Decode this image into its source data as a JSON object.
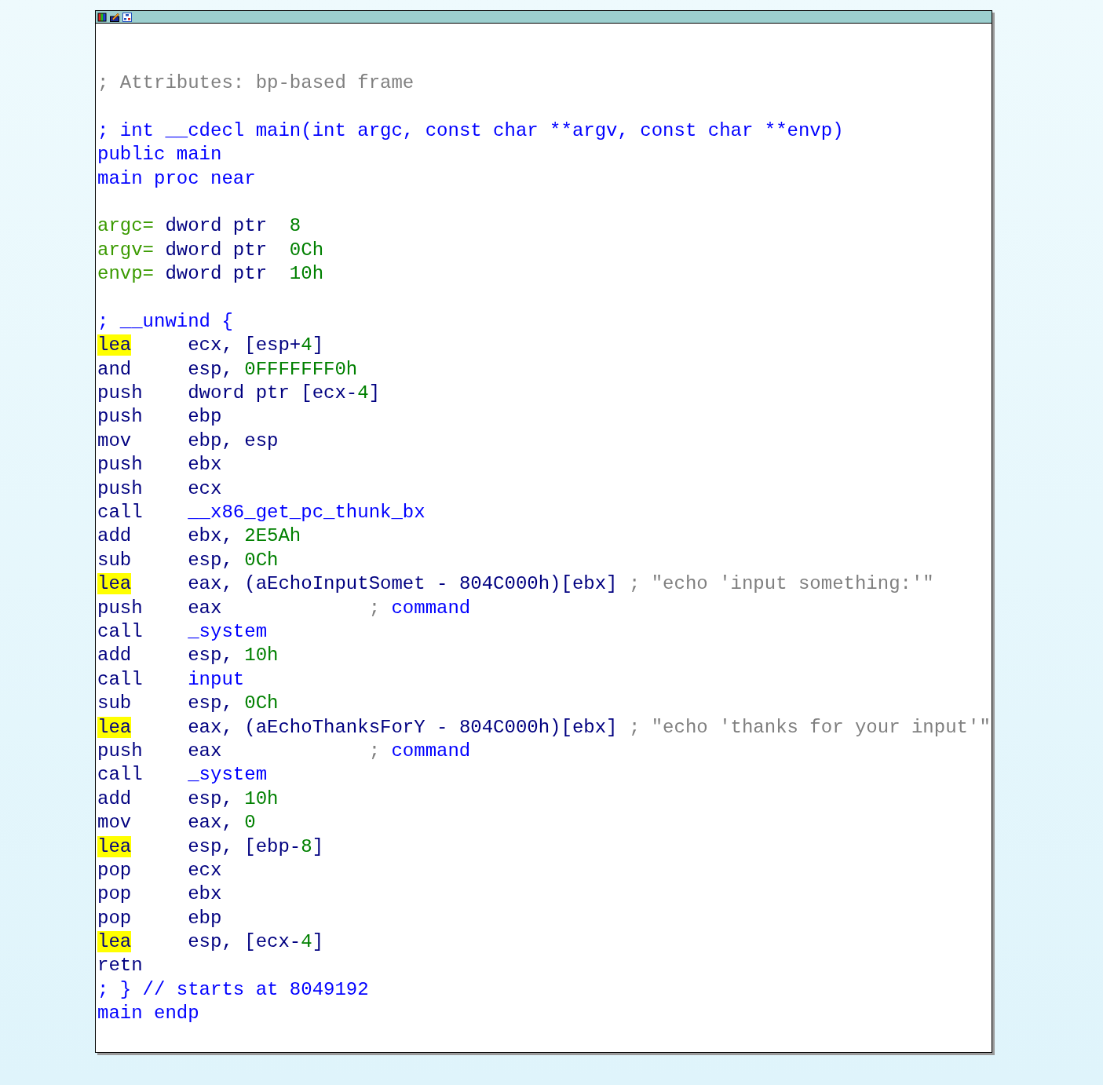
{
  "lines": [
    {
      "kind": "text",
      "spans": [
        {
          "text": "; Attributes: bp-based frame",
          "kind": "comment"
        }
      ]
    },
    {
      "kind": "blank"
    },
    {
      "kind": "text",
      "spans": [
        {
          "text": "; int __cdecl main(int argc, const char **argv, const char **envp)",
          "kind": "name"
        }
      ]
    },
    {
      "kind": "text",
      "spans": [
        {
          "text": "public main",
          "kind": "name"
        }
      ]
    },
    {
      "kind": "text",
      "spans": [
        {
          "text": "main proc near",
          "kind": "name"
        }
      ]
    },
    {
      "kind": "blank"
    },
    {
      "kind": "text",
      "spans": [
        {
          "text": "argc=",
          "kind": "var"
        },
        {
          "text": " dword ptr  ",
          "kind": "plain"
        },
        {
          "text": "8",
          "kind": "number"
        }
      ]
    },
    {
      "kind": "text",
      "spans": [
        {
          "text": "argv=",
          "kind": "var"
        },
        {
          "text": " dword ptr  ",
          "kind": "plain"
        },
        {
          "text": "0Ch",
          "kind": "number"
        }
      ]
    },
    {
      "kind": "text",
      "spans": [
        {
          "text": "envp=",
          "kind": "var"
        },
        {
          "text": " dword ptr  ",
          "kind": "plain"
        },
        {
          "text": "10h",
          "kind": "number"
        }
      ]
    },
    {
      "kind": "blank"
    },
    {
      "kind": "text",
      "spans": [
        {
          "text": "; __unwind {",
          "kind": "name"
        }
      ]
    },
    {
      "kind": "instr",
      "mnemonic": "lea",
      "highlighted": true,
      "operands": [
        {
          "text": "ecx, [esp+",
          "kind": "plain"
        },
        {
          "text": "4",
          "kind": "number"
        },
        {
          "text": "]",
          "kind": "plain"
        }
      ]
    },
    {
      "kind": "instr",
      "mnemonic": "and",
      "highlighted": false,
      "operands": [
        {
          "text": "esp, ",
          "kind": "plain"
        },
        {
          "text": "0FFFFFFF0h",
          "kind": "number"
        }
      ]
    },
    {
      "kind": "instr",
      "mnemonic": "push",
      "highlighted": false,
      "operands": [
        {
          "text": "dword ptr [ecx-",
          "kind": "plain"
        },
        {
          "text": "4",
          "kind": "number"
        },
        {
          "text": "]",
          "kind": "plain"
        }
      ]
    },
    {
      "kind": "instr",
      "mnemonic": "push",
      "highlighted": false,
      "operands": [
        {
          "text": "ebp",
          "kind": "plain"
        }
      ]
    },
    {
      "kind": "instr",
      "mnemonic": "mov",
      "highlighted": false,
      "operands": [
        {
          "text": "ebp, esp",
          "kind": "plain"
        }
      ]
    },
    {
      "kind": "instr",
      "mnemonic": "push",
      "highlighted": false,
      "operands": [
        {
          "text": "ebx",
          "kind": "plain"
        }
      ]
    },
    {
      "kind": "instr",
      "mnemonic": "push",
      "highlighted": false,
      "operands": [
        {
          "text": "ecx",
          "kind": "plain"
        }
      ]
    },
    {
      "kind": "instr",
      "mnemonic": "call",
      "highlighted": false,
      "operands": [
        {
          "text": "__x86_get_pc_thunk_bx",
          "kind": "name"
        }
      ]
    },
    {
      "kind": "instr",
      "mnemonic": "add",
      "highlighted": false,
      "operands": [
        {
          "text": "ebx, ",
          "kind": "plain"
        },
        {
          "text": "2E5Ah",
          "kind": "number"
        }
      ]
    },
    {
      "kind": "instr",
      "mnemonic": "sub",
      "highlighted": false,
      "operands": [
        {
          "text": "esp, ",
          "kind": "plain"
        },
        {
          "text": "0Ch",
          "kind": "number"
        }
      ]
    },
    {
      "kind": "instr",
      "mnemonic": "lea",
      "highlighted": true,
      "operands": [
        {
          "text": "eax, (aEchoInputSomet - 804C000h)[ebx]",
          "kind": "plain"
        }
      ],
      "comment": [
        {
          "text": "; \"echo 'input something:'\"",
          "kind": "comment"
        }
      ]
    },
    {
      "kind": "instr",
      "mnemonic": "push",
      "highlighted": false,
      "operands": [
        {
          "text": "eax",
          "kind": "plain"
        }
      ],
      "comment": [
        {
          "text": "; ",
          "kind": "comment"
        },
        {
          "text": "command",
          "kind": "name"
        }
      ]
    },
    {
      "kind": "instr",
      "mnemonic": "call",
      "highlighted": false,
      "operands": [
        {
          "text": "_system",
          "kind": "name"
        }
      ]
    },
    {
      "kind": "instr",
      "mnemonic": "add",
      "highlighted": false,
      "operands": [
        {
          "text": "esp, ",
          "kind": "plain"
        },
        {
          "text": "10h",
          "kind": "number"
        }
      ]
    },
    {
      "kind": "instr",
      "mnemonic": "call",
      "highlighted": false,
      "operands": [
        {
          "text": "input",
          "kind": "name"
        }
      ]
    },
    {
      "kind": "instr",
      "mnemonic": "sub",
      "highlighted": false,
      "operands": [
        {
          "text": "esp, ",
          "kind": "plain"
        },
        {
          "text": "0Ch",
          "kind": "number"
        }
      ]
    },
    {
      "kind": "instr",
      "mnemonic": "lea",
      "highlighted": true,
      "operands": [
        {
          "text": "eax, (aEchoThanksForY - 804C000h)[ebx]",
          "kind": "plain"
        }
      ],
      "comment": [
        {
          "text": "; \"echo 'thanks for your input'\"",
          "kind": "comment"
        }
      ]
    },
    {
      "kind": "instr",
      "mnemonic": "push",
      "highlighted": false,
      "operands": [
        {
          "text": "eax",
          "kind": "plain"
        }
      ],
      "comment": [
        {
          "text": "; ",
          "kind": "comment"
        },
        {
          "text": "command",
          "kind": "name"
        }
      ]
    },
    {
      "kind": "instr",
      "mnemonic": "call",
      "highlighted": false,
      "operands": [
        {
          "text": "_system",
          "kind": "name"
        }
      ]
    },
    {
      "kind": "instr",
      "mnemonic": "add",
      "highlighted": false,
      "operands": [
        {
          "text": "esp, ",
          "kind": "plain"
        },
        {
          "text": "10h",
          "kind": "number"
        }
      ]
    },
    {
      "kind": "instr",
      "mnemonic": "mov",
      "highlighted": false,
      "operands": [
        {
          "text": "eax, ",
          "kind": "plain"
        },
        {
          "text": "0",
          "kind": "number"
        }
      ]
    },
    {
      "kind": "instr",
      "mnemonic": "lea",
      "highlighted": true,
      "operands": [
        {
          "text": "esp, [ebp-",
          "kind": "plain"
        },
        {
          "text": "8",
          "kind": "number"
        },
        {
          "text": "]",
          "kind": "plain"
        }
      ]
    },
    {
      "kind": "instr",
      "mnemonic": "pop",
      "highlighted": false,
      "operands": [
        {
          "text": "ecx",
          "kind": "plain"
        }
      ]
    },
    {
      "kind": "instr",
      "mnemonic": "pop",
      "highlighted": false,
      "operands": [
        {
          "text": "ebx",
          "kind": "plain"
        }
      ]
    },
    {
      "kind": "instr",
      "mnemonic": "pop",
      "highlighted": false,
      "operands": [
        {
          "text": "ebp",
          "kind": "plain"
        }
      ]
    },
    {
      "kind": "instr",
      "mnemonic": "lea",
      "highlighted": true,
      "operands": [
        {
          "text": "esp, [ecx-",
          "kind": "plain"
        },
        {
          "text": "4",
          "kind": "number"
        },
        {
          "text": "]",
          "kind": "plain"
        }
      ]
    },
    {
      "kind": "instr",
      "mnemonic": "retn",
      "highlighted": false
    },
    {
      "kind": "text",
      "spans": [
        {
          "text": "; } // starts at 8049192",
          "kind": "name"
        }
      ]
    },
    {
      "kind": "text",
      "spans": [
        {
          "text": "main endp",
          "kind": "name"
        }
      ]
    }
  ]
}
